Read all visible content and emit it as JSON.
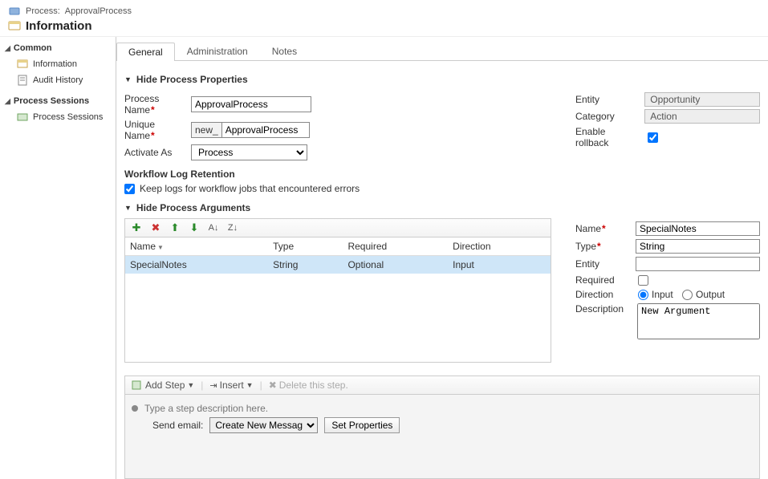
{
  "header": {
    "prefix": "Process:",
    "process_name": "ApprovalProcess",
    "title": "Information"
  },
  "sidebar": {
    "groups": [
      {
        "label": "Common",
        "items": [
          {
            "label": "Information",
            "icon": "info-card-icon"
          },
          {
            "label": "Audit History",
            "icon": "audit-icon"
          }
        ]
      },
      {
        "label": "Process Sessions",
        "items": [
          {
            "label": "Process Sessions",
            "icon": "sessions-icon"
          }
        ]
      }
    ]
  },
  "tabs": [
    "General",
    "Administration",
    "Notes"
  ],
  "active_tab": 0,
  "sections": {
    "hide_props": "Hide Process Properties",
    "hide_args": "Hide Process Arguments"
  },
  "process": {
    "process_name_label": "Process Name",
    "process_name_value": "ApprovalProcess",
    "unique_name_label": "Unique Name",
    "unique_name_prefix": "new_",
    "unique_name_value": "ApprovalProcess",
    "activate_as_label": "Activate As",
    "activate_as_value": "Process",
    "entity_label": "Entity",
    "entity_value": "Opportunity",
    "category_label": "Category",
    "category_value": "Action",
    "enable_rollback_label": "Enable rollback",
    "enable_rollback_checked": true,
    "workflow_log_hdr": "Workflow Log Retention",
    "keep_logs_label": "Keep logs for workflow jobs that encountered errors",
    "keep_logs_checked": true
  },
  "args": {
    "toolbar_icons": [
      "add",
      "delete",
      "up",
      "down",
      "sort-asc",
      "sort-desc"
    ],
    "cols": [
      "Name",
      "Type",
      "Required",
      "Direction"
    ],
    "rows": [
      {
        "name": "SpecialNotes",
        "type": "String",
        "required": "Optional",
        "direction": "Input",
        "selected": true
      }
    ]
  },
  "arg_detail": {
    "name_label": "Name",
    "name_value": "SpecialNotes",
    "type_label": "Type",
    "type_value": "String",
    "entity_label": "Entity",
    "entity_value": "",
    "required_label": "Required",
    "required_checked": false,
    "direction_label": "Direction",
    "direction_value": "Input",
    "direction_options": [
      "Input",
      "Output"
    ],
    "description_label": "Description",
    "description_value": "New Argument"
  },
  "steps": {
    "add_step_label": "Add Step",
    "insert_label": "Insert",
    "delete_label": "Delete this step.",
    "step_desc_placeholder": "Type a step description here.",
    "send_email_label": "Send email:",
    "send_email_option": "Create New Message",
    "set_properties_label": "Set Properties"
  }
}
